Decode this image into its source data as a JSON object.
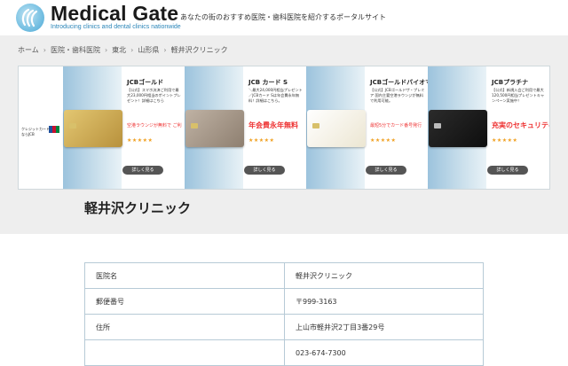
{
  "header": {
    "site_name": "Medical Gate",
    "site_subtitle": "Introducing clinics and dental clinics nationwide",
    "tagline": "あなたの街のおすすめ医院・歯科医院を紹介するポータルサイト"
  },
  "breadcrumb": [
    "ホーム",
    "医院・歯科医院",
    "東北",
    "山形県",
    "軽井沢クリニック"
  ],
  "ad": {
    "left_text": [
      "クレジットカード",
      "ならJCB"
    ],
    "items": [
      {
        "title": "JCBゴールド",
        "desc": "【公式】スマホ決済ご利用で最大23,000円相当のポイントプレゼント！詳細はこちら",
        "highlight": "空港ラウンジが無料で ご利",
        "stars": "★★★★★",
        "button": "詳しく見る",
        "card_color": "#c9a24a"
      },
      {
        "title": "JCB カード S",
        "desc": "＼最大24,000円相当プレゼント／JCBカード Sは年会費永年無料！詳細はこちら。",
        "highlight": "年会費永年無料",
        "stars": "★★★★★",
        "button": "詳しく見る",
        "card_color": "#a89888"
      },
      {
        "title": "JCBゴールドバイオマス",
        "desc": "【公式】JCBゴールドザ・プレミア 国内主要空港ラウンジが無料で利用可能。",
        "highlight": "最短5分でカード番号発行",
        "stars": "★★★★★",
        "button": "詳しく見る",
        "card_color": "#f4f1e6"
      },
      {
        "title": "JCBプラチナ",
        "desc": "【公式】新規入会ご利用で最大120,500円相当プレゼントキャンペーン実施中！",
        "highlight": "充実のセキュリティ",
        "stars": "★★★★★",
        "button": "詳しく見る",
        "card_color": "#1c1c1c"
      }
    ]
  },
  "page_title": "軽井沢クリニック",
  "table": [
    {
      "label": "医院名",
      "value": "軽井沢クリニック"
    },
    {
      "label": "郵便番号",
      "value": "〒999-3163"
    },
    {
      "label": "住所",
      "value": "上山市軽井沢2丁目3番29号"
    },
    {
      "label": "",
      "value": "023-674-7300"
    }
  ],
  "colors": {
    "accent": "#2a85b8",
    "band": "#eeeeee",
    "border": "#b7cad6"
  }
}
